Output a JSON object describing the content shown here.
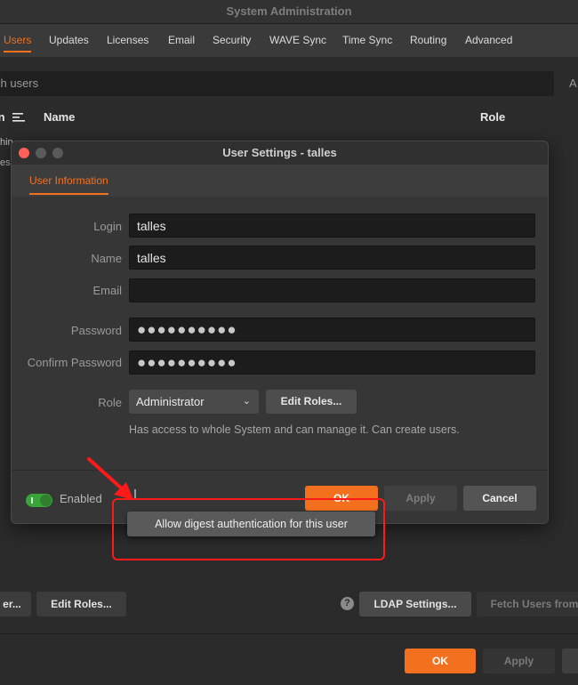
{
  "window": {
    "title": "System Administration"
  },
  "tabs": [
    "Users",
    "Updates",
    "Licenses",
    "Email",
    "Security",
    "WAVE Sync",
    "Time Sync",
    "Routing",
    "Advanced"
  ],
  "search": {
    "placeholder": "ch users",
    "trailing": "A"
  },
  "table": {
    "headers": [
      "in",
      "Name",
      "Role"
    ],
    "row_fragments": [
      "hin",
      "es"
    ]
  },
  "dialog": {
    "title": "User Settings - talles",
    "tab": "User Information",
    "fields": {
      "login_label": "Login",
      "login_value": "talles",
      "name_label": "Name",
      "name_value": "talles",
      "email_label": "Email",
      "email_value": "",
      "password_label": "Password",
      "password_value": "●●●●●●●●●●",
      "confirm_label": "Confirm Password",
      "confirm_value": "●●●●●●●●●●",
      "role_label": "Role",
      "role_value": "Administrator",
      "edit_roles": "Edit Roles...",
      "role_description": "Has access to whole System and can manage it. Can create users."
    },
    "enabled_label": "Enabled",
    "ok": "OK",
    "apply": "Apply",
    "cancel": "Cancel",
    "tooltip": "Allow digest authentication for this user"
  },
  "bottom": {
    "left_partial": "er...",
    "edit_roles": "Edit Roles...",
    "help": "?",
    "ldap": "LDAP Settings...",
    "fetch": "Fetch Users from",
    "ok": "OK",
    "apply": "Apply"
  },
  "colors": {
    "accent": "#f3701f",
    "annotation": "#ff1a1a",
    "toggle_on": "#3aa43a"
  }
}
